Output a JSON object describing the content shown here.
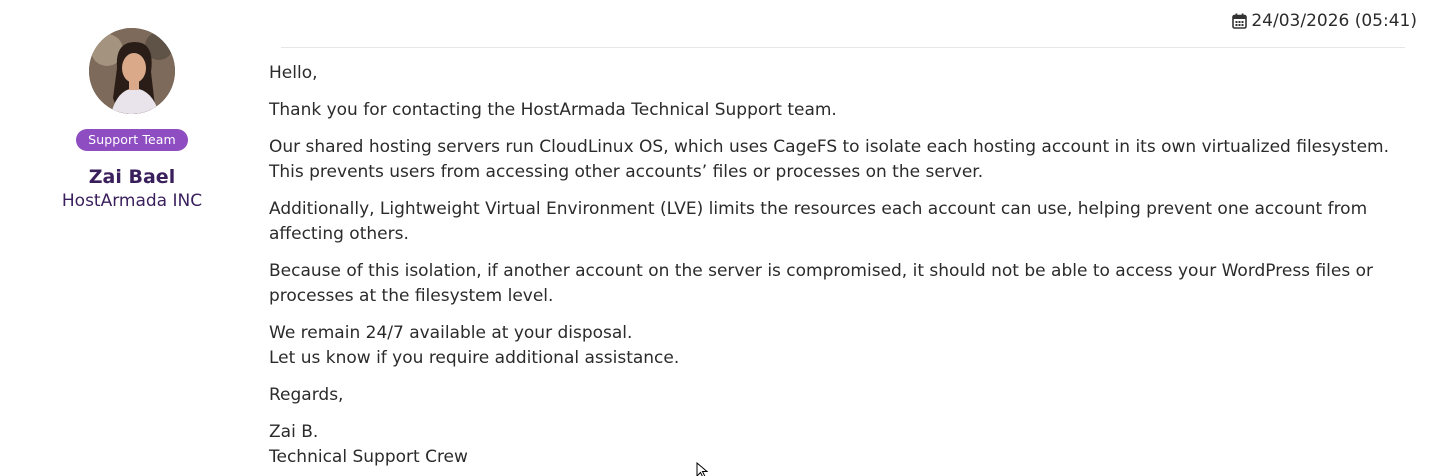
{
  "timestamp": "24/03/2026 (05:41)",
  "icons": {
    "timestamp_icon": "calendar-icon",
    "avatar_icon": "avatar",
    "cursor_icon": "mouse-pointer-icon"
  },
  "colors": {
    "badge_bg": "#8e4dc1",
    "author_text": "#3a1f5d"
  },
  "author": {
    "badge": "Support Team",
    "name": "Zai Bael",
    "company": "HostArmada INC"
  },
  "message": {
    "greeting": "Hello,",
    "thanks": "Thank you for contacting the HostArmada Technical Support team.",
    "para1_line1": "Our shared hosting servers run CloudLinux OS, which uses CageFS to isolate each hosting account in its own virtualized filesystem.",
    "para1_line2": "This prevents users from accessing other accounts’ files or processes on the server.",
    "para2": "Additionally, Lightweight Virtual Environment (LVE) limits the resources each account can use, helping prevent one account from affecting others.",
    "para3": "Because of this isolation, if another account on the server is compromised, it should not be able to access your WordPress files or processes at the filesystem level.",
    "availability_line1": "We remain 24/7 available at your disposal.",
    "availability_line2": "Let us know if you require additional assistance.",
    "regards": "Regards,",
    "signature_name": "Zai B.",
    "signature_title": "Technical Support Crew"
  }
}
